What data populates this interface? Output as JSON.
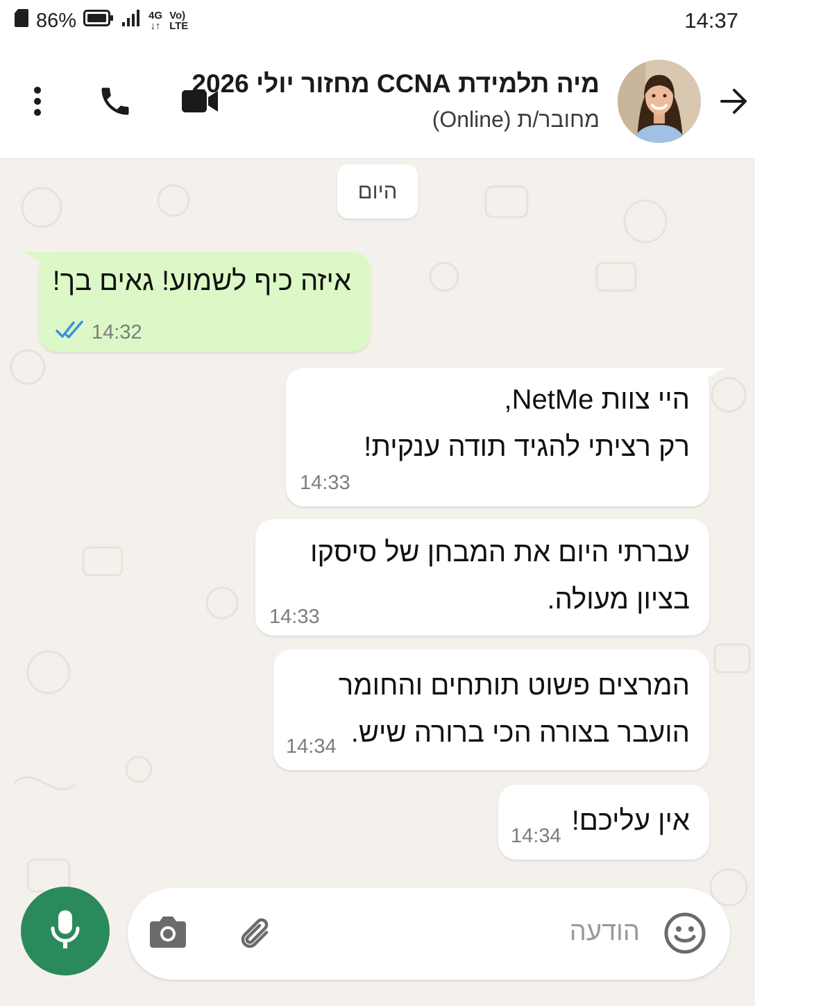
{
  "status_bar": {
    "battery_percent": "86%",
    "network": "4G",
    "volte": "Vo) LTE",
    "time": "14:37"
  },
  "header": {
    "contact_name": "מיה תלמידת CCNA מחזור יולי 2026",
    "contact_status": "מחובר/ת (Online)",
    "icons": [
      "more-vert-icon",
      "phone-icon",
      "video-call-icon",
      "arrow-right-icon"
    ]
  },
  "chat": {
    "date_divider": "היום",
    "messages": [
      {
        "direction": "outgoing",
        "lines": [
          "איזה כיף לשמוע! גאים בך!"
        ],
        "time": "14:32",
        "read": true
      },
      {
        "direction": "incoming",
        "lines": [
          "היי צוות NetMe,",
          "רק רציתי להגיד תודה ענקית!"
        ],
        "time": "14:33"
      },
      {
        "direction": "incoming",
        "lines": [
          "עברתי היום את המבחן של סיסקו",
          "בציון מעולה."
        ],
        "time": "14:33"
      },
      {
        "direction": "incoming",
        "lines": [
          "המרצים פשוט תותחים והחומר",
          "הועבר בצורה הכי ברורה שיש."
        ],
        "time": "14:34"
      },
      {
        "direction": "incoming",
        "lines": [
          "אין עליכם!"
        ],
        "time": "14:34"
      }
    ]
  },
  "composer": {
    "placeholder": "הודעה",
    "icons": [
      "emoji-icon",
      "attach-icon",
      "camera-icon",
      "mic-icon"
    ]
  },
  "colors": {
    "accent": "#2b8a5b",
    "outgoing_bubble": "#dcf8c6",
    "incoming_bubble": "#ffffff",
    "chat_background": "#f4f1ec",
    "read_ticks": "#3d8fe0"
  }
}
